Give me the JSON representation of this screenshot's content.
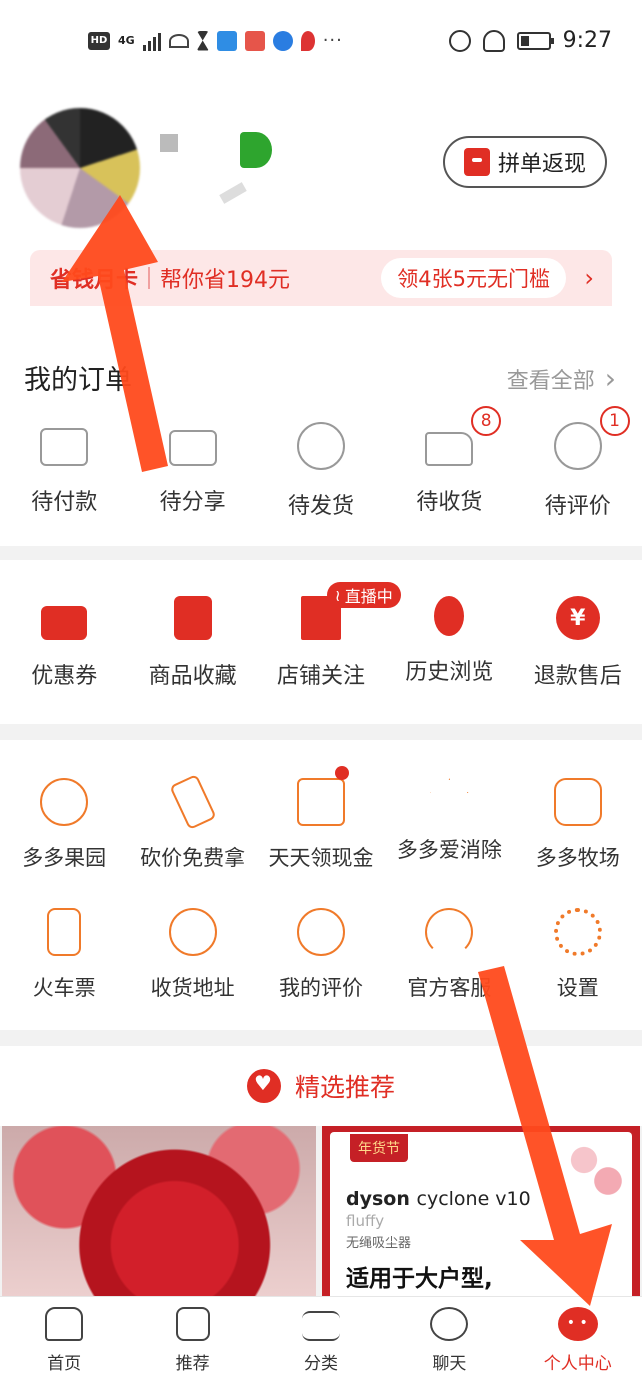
{
  "status_bar": {
    "time": "9:27",
    "net_label": "HD",
    "signal": "4G"
  },
  "header": {
    "refund_button_label": "拼单返现"
  },
  "saving_banner": {
    "prefix": "省钱月卡",
    "text": "帮你省194元",
    "coupon_text": "领4张5元无门槛"
  },
  "orders": {
    "title": "我的订单",
    "view_all": "查看全部",
    "items": [
      {
        "label": "待付款",
        "icon": "wallet-icon",
        "badge": ""
      },
      {
        "label": "待分享",
        "icon": "share-icon",
        "badge": ""
      },
      {
        "label": "待发货",
        "icon": "clock-icon",
        "badge": ""
      },
      {
        "label": "待收货",
        "icon": "truck-icon",
        "badge": "8"
      },
      {
        "label": "待评价",
        "icon": "star-comment-icon",
        "badge": "1"
      }
    ]
  },
  "services": {
    "live_tag": "直播中",
    "items": [
      {
        "label": "优惠券",
        "icon": "coupon-icon"
      },
      {
        "label": "商品收藏",
        "icon": "favorite-bag-icon"
      },
      {
        "label": "店铺关注",
        "icon": "store-icon"
      },
      {
        "label": "历史浏览",
        "icon": "footprint-icon"
      },
      {
        "label": "退款售后",
        "icon": "yen-icon"
      }
    ]
  },
  "tools": {
    "row1": [
      {
        "label": "多多果园",
        "icon": "tree-icon"
      },
      {
        "label": "砍价免费拿",
        "icon": "axe-icon"
      },
      {
        "label": "天天领现金",
        "icon": "cash-envelope-icon"
      },
      {
        "label": "多多爱消除",
        "icon": "star-wand-icon"
      },
      {
        "label": "多多牧场",
        "icon": "cow-icon"
      }
    ],
    "row2": [
      {
        "label": "火车票",
        "icon": "train-icon"
      },
      {
        "label": "收货地址",
        "icon": "location-icon"
      },
      {
        "label": "我的评价",
        "icon": "comment-icon"
      },
      {
        "label": "官方客服",
        "icon": "headset-icon"
      },
      {
        "label": "设置",
        "icon": "gear-icon"
      }
    ]
  },
  "recommend": {
    "title": "精选推荐",
    "product2": {
      "tag": "年货节",
      "brand": "dyson",
      "model": "cyclone v10",
      "variant": "fluffy",
      "desc": "无绳吸尘器",
      "slogan": "适用于大户型,"
    }
  },
  "tabbar": {
    "items": [
      {
        "label": "首页",
        "icon": "home-icon"
      },
      {
        "label": "推荐",
        "icon": "recommend-icon"
      },
      {
        "label": "分类",
        "icon": "category-list-icon"
      },
      {
        "label": "聊天",
        "icon": "chat-icon"
      },
      {
        "label": "个人中心",
        "icon": "profile-icon"
      }
    ],
    "active_color": "#e02e24"
  },
  "colors": {
    "accent": "#e02e24",
    "tool_icon": "#f07a2a",
    "annotation_arrow": "#ff4a1c"
  }
}
